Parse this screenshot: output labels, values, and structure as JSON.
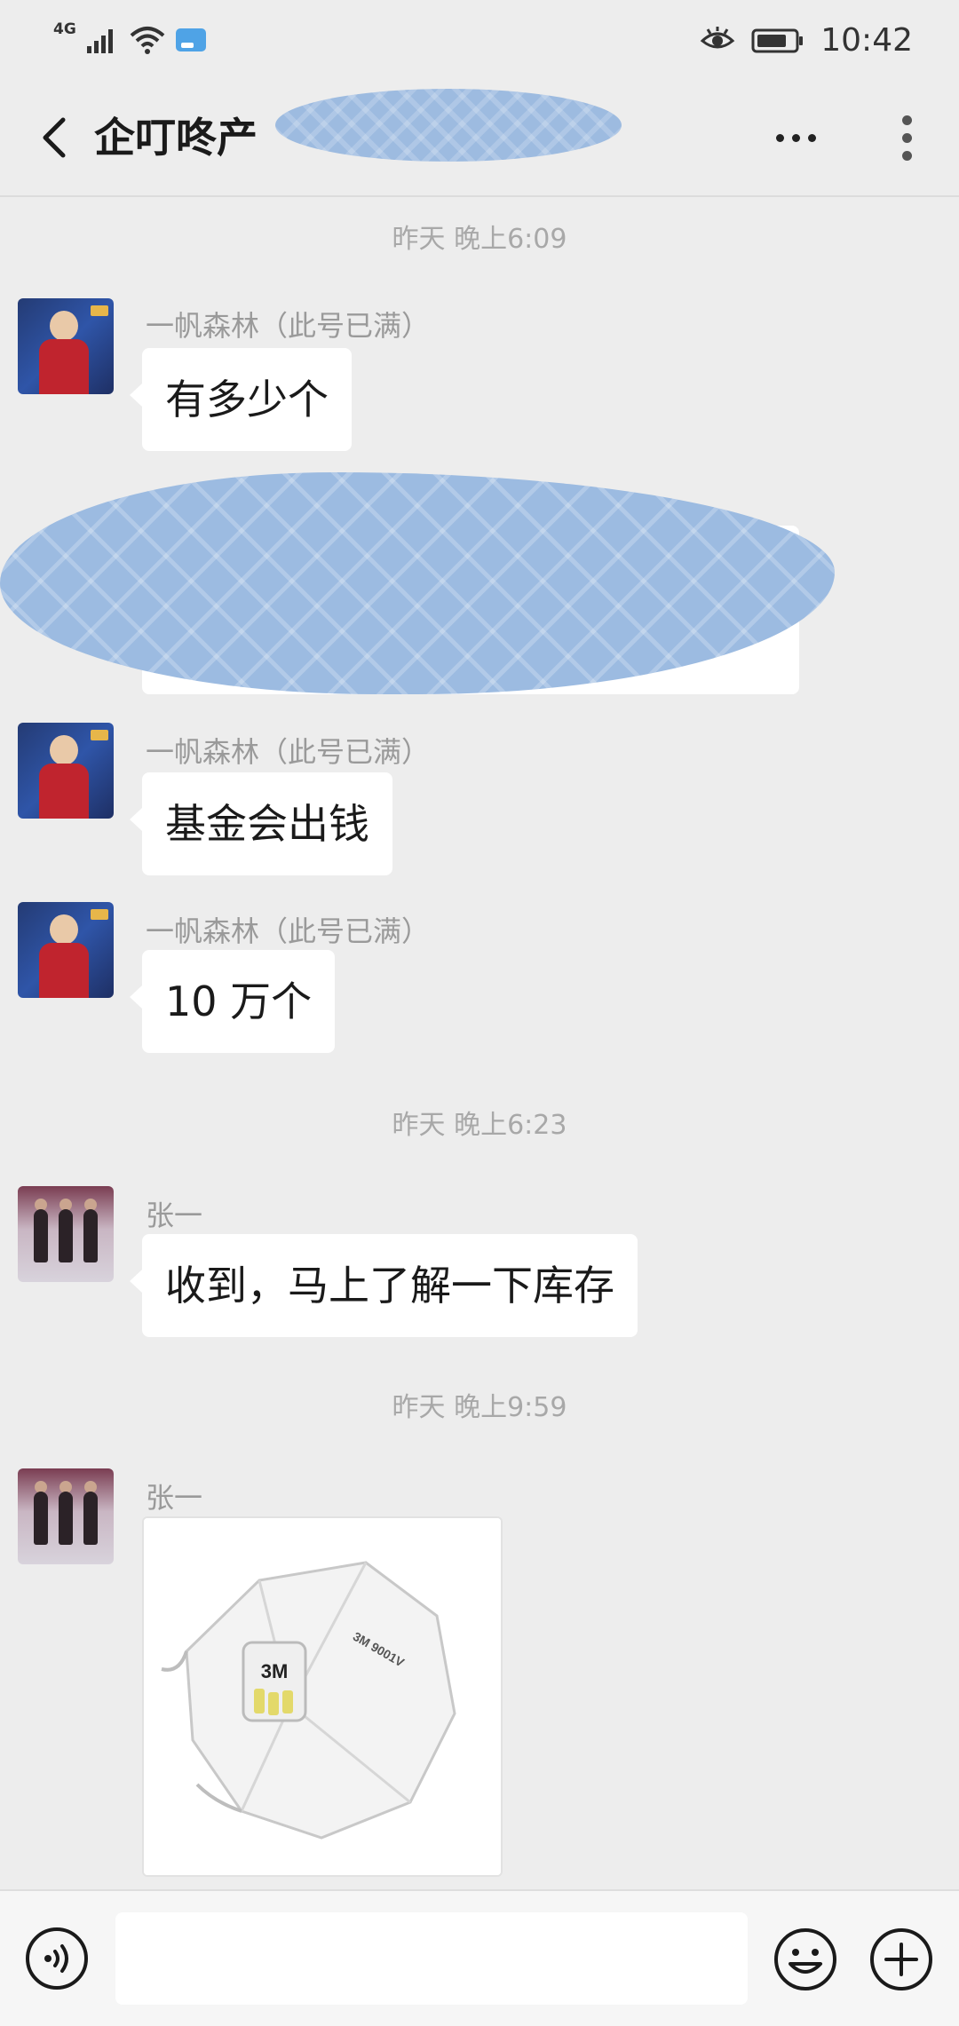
{
  "status_bar": {
    "network": "4G",
    "time": "10:42"
  },
  "header": {
    "title": "企叮咚产"
  },
  "messages": [
    {
      "type": "timestamp",
      "text": "昨天 晚上6:09"
    },
    {
      "type": "text",
      "sender": "一帆森林（此号已满）",
      "text": "有多少个"
    },
    {
      "type": "redacted"
    },
    {
      "type": "text",
      "sender": "一帆森林（此号已满）",
      "text": "基金会出钱"
    },
    {
      "type": "text",
      "sender": "一帆森林（此号已满）",
      "text": "10 万个"
    },
    {
      "type": "timestamp",
      "text": "昨天 晚上6:23"
    },
    {
      "type": "text",
      "sender": "张一",
      "text": "收到，马上了解一下库存"
    },
    {
      "type": "timestamp",
      "text": "昨天 晚上9:59"
    },
    {
      "type": "image",
      "sender": "张一",
      "image": {
        "brand": "3M",
        "model": "3M 9001V"
      }
    }
  ],
  "input_bar": {
    "text_value": "",
    "voice_icon": "voice-icon",
    "emoji_icon": "emoji-icon",
    "plus_icon": "plus-icon"
  }
}
